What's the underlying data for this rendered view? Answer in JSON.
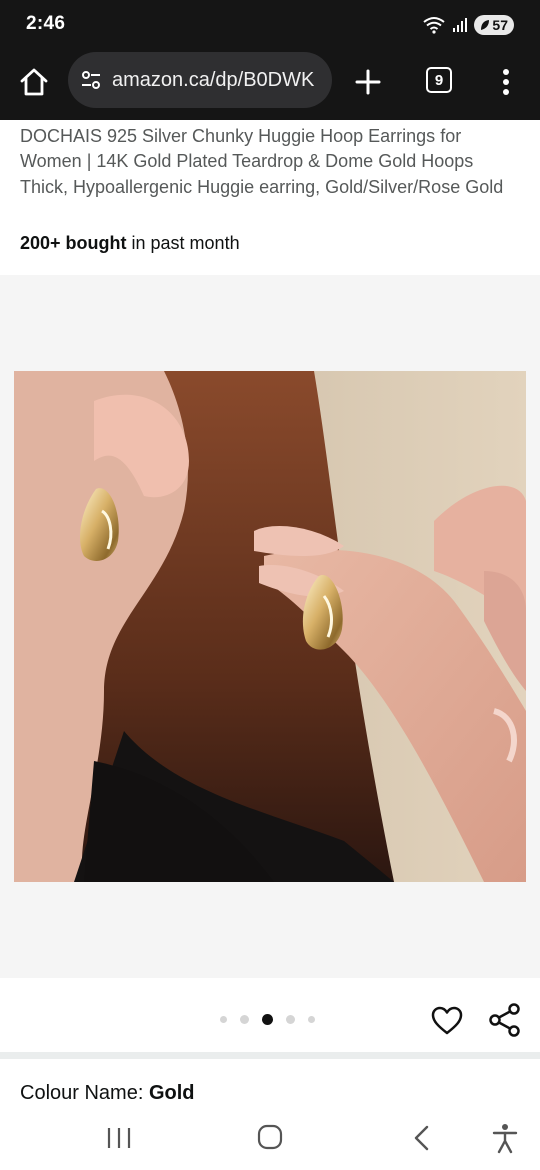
{
  "status": {
    "time": "2:46",
    "battery": "57",
    "icons": [
      "wifi-icon",
      "signal-icon",
      "battery-saver-icon"
    ]
  },
  "browser": {
    "url": "amazon.ca/dp/B0DWK",
    "tab_count": "9",
    "icons": [
      "home-icon",
      "site-settings-icon",
      "plus-icon",
      "tabs-icon",
      "more-vert-icon"
    ]
  },
  "product": {
    "title": "DOCHAIS 925 Silver Chunky Huggie Hoop Earrings for Women | 14K Gold Plated Teardrop & Dome Gold Hoops Thick, Hypoallergenic Huggie earring, Gold/Silver/Rose Gold",
    "bought_bold": "200+ bought",
    "bought_rest": " in past month"
  },
  "gallery": {
    "image_count": 5,
    "active_index": 2,
    "icons": [
      "heart-icon",
      "share-icon"
    ]
  },
  "variant": {
    "label": "Colour Name: ",
    "value": "Gold"
  },
  "nav": {
    "icons": [
      "recents-icon",
      "home-circle-icon",
      "back-icon",
      "accessibility-icon"
    ]
  },
  "colors": {
    "chrome_bg": "#151515",
    "url_pill_bg": "#2f2f31",
    "title_text": "#565959",
    "gallery_bg": "#f5f5f5"
  }
}
